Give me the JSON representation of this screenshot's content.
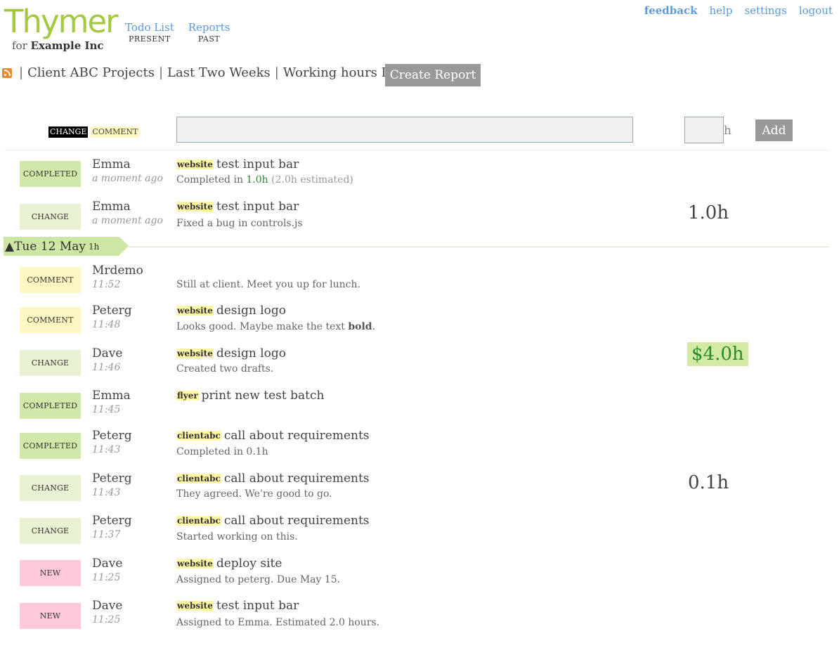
{
  "app": {
    "logo": "Thymer",
    "for_prefix": "for",
    "company": "Example Inc"
  },
  "nav": [
    {
      "label": "Todo List",
      "sub": "PRESENT"
    },
    {
      "label": "Reports",
      "sub": "PAST"
    }
  ],
  "top_links": [
    "feedback",
    "help",
    "settings",
    "logout"
  ],
  "report": {
    "filters": [
      "Client ABC Projects",
      "Last Two Weeks",
      "Working hours Dave"
    ],
    "separator": "|",
    "create_label": "Create Report"
  },
  "entry": {
    "type_change": "CHANGE",
    "type_comment": "COMMENT",
    "text_value": "",
    "hours_value": "",
    "hours_unit": "h",
    "add_label": "Add"
  },
  "day_divider": {
    "arrow": "▲",
    "label": "Tue 12 May",
    "hours": "1h"
  },
  "totals": [
    "1.0h",
    "$4.0h",
    "0.1h"
  ],
  "feed": [
    {
      "type": "COMPLETED",
      "user": "Emma",
      "time": "a moment ago",
      "tag": "website",
      "task": "test input bar",
      "detail_prefix": "Completed in ",
      "detail_hl": "1.0h",
      "detail_muted": " (2.0h estimated)"
    },
    {
      "type": "CHANGE",
      "user": "Emma",
      "time": "a moment ago",
      "tag": "website",
      "task": "test input bar",
      "detail": "Fixed a bug in controls.js"
    },
    {
      "type": "COMMENT",
      "user": "Mrdemo",
      "time": "11:52",
      "detail": "Still at client. Meet you up for lunch."
    },
    {
      "type": "COMMENT",
      "user": "Peterg",
      "time": "11:48",
      "tag": "website",
      "task": "design logo",
      "detail_prefix": "Looks good. Maybe make the text ",
      "detail_bold": "bold",
      "detail_suffix": "."
    },
    {
      "type": "CHANGE",
      "user": "Dave",
      "time": "11:46",
      "tag": "website",
      "task": "design logo",
      "detail": "Created two drafts."
    },
    {
      "type": "COMPLETED",
      "user": "Emma",
      "time": "11:45",
      "tag": "flyer",
      "task": "print new test batch"
    },
    {
      "type": "COMPLETED",
      "user": "Peterg",
      "time": "11:43",
      "tag": "clientabc",
      "task": "call about requirements",
      "detail": "Completed in 0.1h"
    },
    {
      "type": "CHANGE",
      "user": "Peterg",
      "time": "11:43",
      "tag": "clientabc",
      "task": "call about requirements",
      "detail": "They agreed. We're good to go."
    },
    {
      "type": "CHANGE",
      "user": "Peterg",
      "time": "11:37",
      "tag": "clientabc",
      "task": "call about requirements",
      "detail": "Started working on this."
    },
    {
      "type": "NEW",
      "user": "Dave",
      "time": "11:25",
      "tag": "website",
      "task": "deploy site",
      "detail": "Assigned to peterg. Due May 15."
    },
    {
      "type": "NEW",
      "user": "Dave",
      "time": "11:25",
      "tag": "website",
      "task": "test input bar",
      "detail": "Assigned to Emma. Estimated 2.0 hours."
    }
  ]
}
